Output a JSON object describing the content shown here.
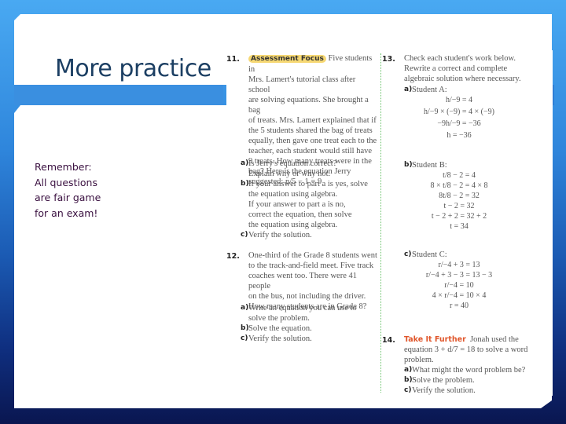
{
  "slide": {
    "title": "More practice",
    "note_lines": [
      "Remember:",
      "All questions",
      "are fair game",
      "for an exam!"
    ]
  },
  "textbook": {
    "q11": {
      "number": "11.",
      "tag": "Assessment Focus",
      "lines": [
        "Five students in",
        "Mrs. Lamert's tutorial class after school",
        "are solving equations. She brought a bag",
        "of treats. Mrs. Lamert explained that if",
        "the 5 students shared the bag of treats",
        "equally, then gave one treat each to the",
        "teacher, each student would still have",
        "9 treats. How many treats were in the",
        "bag? Here is the equation Jerry",
        "suggested: n/5 − 1 = 9"
      ],
      "parts": [
        {
          "label": "a)",
          "lines": [
            "Is Jerry's equation correct?",
            "Explain why or why not."
          ]
        },
        {
          "label": "b)",
          "lines": [
            "If your answer to part a is yes, solve",
            "the equation using algebra.",
            "If your answer to part a is no,",
            "correct the equation, then solve",
            "the equation using algebra."
          ]
        },
        {
          "label": "c)",
          "lines": [
            "Verify the solution."
          ]
        }
      ]
    },
    "q12": {
      "number": "12.",
      "lines": [
        "One-third of the Grade 8 students went",
        "to the track-and-field meet. Five track",
        "coaches went too. There were 41 people",
        "on the bus, not including the driver.",
        "How many students are in Grade 8?"
      ],
      "parts": [
        {
          "label": "a)",
          "lines": [
            "Write an equation you can use to",
            "solve the problem."
          ]
        },
        {
          "label": "b)",
          "lines": [
            "Solve the equation."
          ]
        },
        {
          "label": "c)",
          "lines": [
            "Verify the solution."
          ]
        }
      ]
    },
    "q13": {
      "number": "13.",
      "lines": [
        "Check each student's work below.",
        "Rewrite a correct and complete",
        "algebraic solution where necessary."
      ],
      "students": [
        {
          "label": "a)",
          "name": "Student A:",
          "steps": [
            "h/−9 = 4",
            "h/−9 × (−9) = 4 × (−9)",
            "−9h/−9 = −36",
            "h = −36"
          ]
        },
        {
          "label": "b)",
          "name": "Student B:",
          "steps": [
            "t/8 − 2 = 4",
            "8 × t/8 − 2 = 4 × 8",
            "8t/8 − 2 = 32",
            "t − 2 = 32",
            "t − 2 + 2 = 32 + 2",
            "t = 34"
          ]
        },
        {
          "label": "c)",
          "name": "Student C:",
          "steps": [
            "r/−4 + 3 = 13",
            "r/−4 + 3 − 3 = 13 − 3",
            "r/−4 = 10",
            "4 × r/−4 = 10 × 4",
            "r = 40"
          ]
        }
      ]
    },
    "q14": {
      "number": "14.",
      "tag": "Take It Further",
      "lines": [
        "Jonah used the",
        "equation 3 + d/7 = 18 to solve a word",
        "problem."
      ],
      "parts": [
        {
          "label": "a)",
          "lines": [
            "What might the word problem be?"
          ]
        },
        {
          "label": "b)",
          "lines": [
            "Solve the problem."
          ]
        },
        {
          "label": "c)",
          "lines": [
            "Verify the solution."
          ]
        }
      ]
    }
  },
  "colors": {
    "title_text": "#1c3f63",
    "note_text": "#3a1040",
    "assessment_highlight": "#f6d873",
    "take_it_further": "#e0562b",
    "divider": "#6cc36c"
  }
}
